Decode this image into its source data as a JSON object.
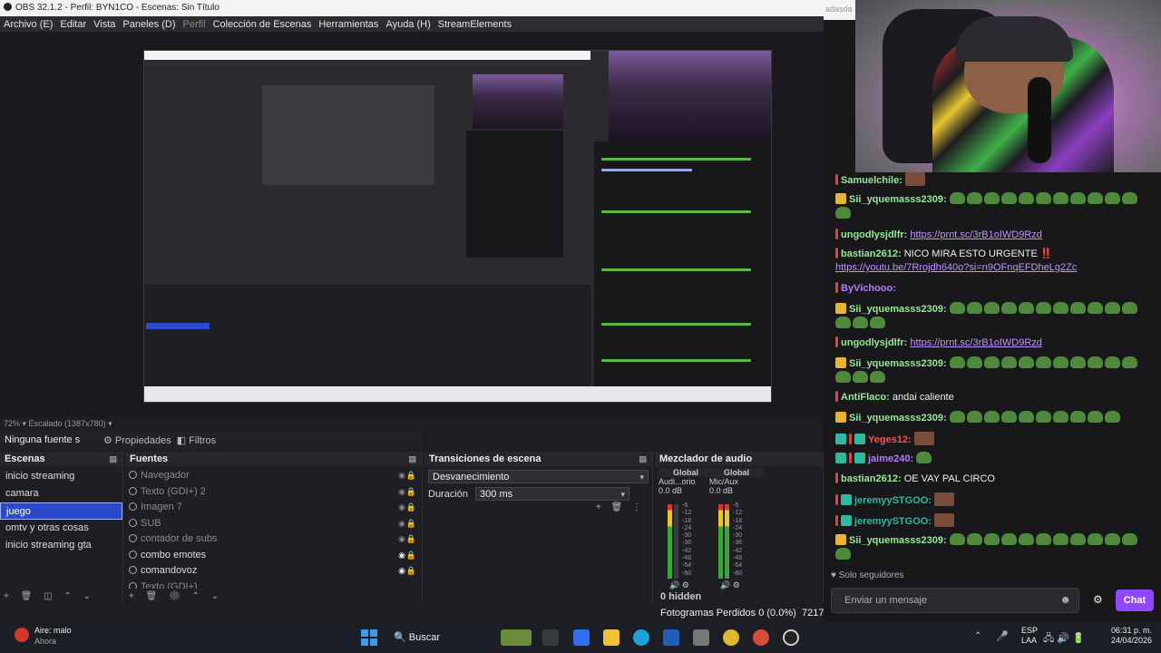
{
  "window": {
    "title": "OBS 32.1.2 - Perfil: BYN1CO - Escenas: Sin Título"
  },
  "menu": [
    "Archivo (E)",
    "Editar",
    "Vista",
    "Paneles (D)",
    "Perfil",
    "Colección de Escenas",
    "Herramientas",
    "Ayuda (H)",
    "StreamElements"
  ],
  "preview": {
    "status": "72%  ▾  Escalado (1387x780)  ▾"
  },
  "source_toolbar": {
    "selected": "Ninguna fuente s",
    "properties": "Propiedades",
    "filters": "Filtros"
  },
  "scenes": {
    "title": "Escenas",
    "items": [
      "inicio streaming",
      "camara",
      "juego",
      "omtv y otras cosas",
      "inicio streaming gta"
    ],
    "selected_index": 2
  },
  "sources": {
    "title": "Fuentes",
    "items": [
      {
        "label": "Navegador",
        "dim": true
      },
      {
        "label": "Texto (GDI+) 2",
        "dim": true
      },
      {
        "label": "Imagen 7",
        "dim": true
      },
      {
        "label": "SUB",
        "dim": true
      },
      {
        "label": "contador de subs",
        "dim": true
      },
      {
        "label": "combo emotes",
        "dim": false
      },
      {
        "label": "comandovoz",
        "dim": false
      },
      {
        "label": "Texto (GDI+)",
        "dim": true
      }
    ]
  },
  "transitions": {
    "title": "Transiciones de escena",
    "selected": "Desvanecimiento",
    "duration_label": "Duración",
    "duration_value": "300 ms"
  },
  "mixer": {
    "title": "Mezclador de audio",
    "channels": [
      {
        "tab": "Global",
        "name": "Audi...orio",
        "db": "0.0 dB"
      },
      {
        "tab": "Global",
        "name": "Mic/Aux",
        "db": "0.0 dB"
      }
    ],
    "ticks": [
      "-6",
      "-12",
      "-18",
      "-24",
      "-30",
      "-36",
      "-42",
      "-48",
      "-54",
      "-60"
    ],
    "hidden": "0 hidden"
  },
  "stats": {
    "dropped": "Fotogramas Perdidos 0 (0.0%)",
    "bitrate": "7217"
  },
  "chat": {
    "corner_text": "adasda",
    "messages": [
      {
        "user": "Samuelchile:",
        "color": "#9ae69a",
        "badges": [
          "mod"
        ],
        "text": "",
        "emotes": 0,
        "pic": true
      },
      {
        "user": "Sii_yquemasss2309:",
        "color": "#9ae69a",
        "badges": [
          "crown"
        ],
        "text": "",
        "emotes": 12
      },
      {
        "user": "ungodlysjdlfr:",
        "color": "#9ae69a",
        "badges": [
          "mod"
        ],
        "link": "https://prnt.sc/3rB1oIWD9Rzd"
      },
      {
        "user": "bastian2612:",
        "color": "#9ae69a",
        "badges": [
          "mod"
        ],
        "text": "NICO MIRA ESTO URGENTE ‼️",
        "link2": "https://youtu.be/7Rrojdh640o?si=n9OFnqEFDheLg2Zc"
      },
      {
        "user": "ByVichooo:",
        "color": "#b37bff",
        "badges": [
          "mod"
        ],
        "text": "",
        "emotes": 0
      },
      {
        "user": "Sii_yquemasss2309:",
        "color": "#9ae69a",
        "badges": [
          "crown"
        ],
        "text": "",
        "emotes": 14
      },
      {
        "user": "ungodlysjdlfr:",
        "color": "#9ae69a",
        "badges": [
          "mod"
        ],
        "link": "https://prnt.sc/3rB1oIWD9Rzd"
      },
      {
        "user": "Sii_yquemasss2309:",
        "color": "#9ae69a",
        "badges": [
          "crown"
        ],
        "text": "",
        "emotes": 14
      },
      {
        "user": "AntiFlaco:",
        "color": "#9ae69a",
        "badges": [
          "mod"
        ],
        "text": "andai caliente"
      },
      {
        "user": "Sii_yquemasss2309:",
        "color": "#9ae69a",
        "badges": [
          "crown"
        ],
        "text": "",
        "emotes": 10
      },
      {
        "user": "Yeges12:",
        "color": "#ff4f4f",
        "badges": [
          "vip",
          "mod",
          "vip"
        ],
        "text": "",
        "pic": true
      },
      {
        "user": "jaime240:",
        "color": "#b37bff",
        "badges": [
          "vip",
          "mod",
          "vip"
        ],
        "text": "",
        "emotes": 1
      },
      {
        "user": "bastian2612:",
        "color": "#9ae69a",
        "badges": [
          "mod"
        ],
        "text": "OE VAY PAL CIRCO"
      },
      {
        "user": "jeremyySTGOO:",
        "color": "#2fb8a0",
        "badges": [
          "mod",
          "vip"
        ],
        "text": "",
        "pic": true
      },
      {
        "user": "jeremyySTGOO:",
        "color": "#2fb8a0",
        "badges": [
          "mod",
          "vip"
        ],
        "text": "",
        "pic": true
      },
      {
        "user": "Sii_yquemasss2309:",
        "color": "#9ae69a",
        "badges": [
          "crown"
        ],
        "text": "",
        "emotes": 12
      }
    ],
    "followers_only": "Solo seguidores",
    "input_placeholder": "Enviar un mensaje",
    "send": "Chat"
  },
  "taskbar": {
    "weather_title": "Aire: malo",
    "weather_sub": "Ahora",
    "search": "Buscar",
    "lang1": "ESP",
    "lang2": "LAA",
    "time": "06:31 p. m.",
    "date": "24/04/2026"
  },
  "colors": {
    "accent_obs_select": "#2b4acb",
    "twitch_purple": "#9147ff"
  }
}
